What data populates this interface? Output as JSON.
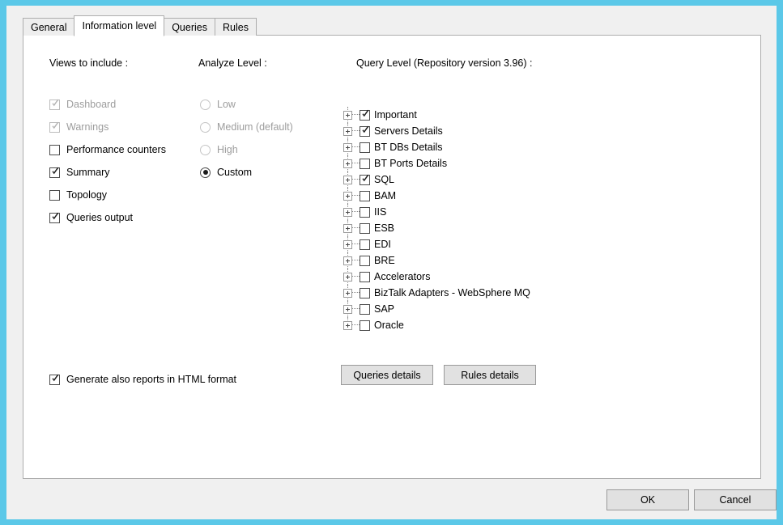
{
  "window": {
    "frame_color": "#5bc8e8",
    "dialog_background": "#f0f0f0",
    "panel_background": "#ffffff"
  },
  "tabs": [
    {
      "label": "General",
      "active": false
    },
    {
      "label": "Information level",
      "active": true
    },
    {
      "label": "Queries",
      "active": false
    },
    {
      "label": "Rules",
      "active": false
    }
  ],
  "views": {
    "header": "Views to include :",
    "items": [
      {
        "label": "Dashboard",
        "checked": true,
        "enabled": false
      },
      {
        "label": "Warnings",
        "checked": true,
        "enabled": false
      },
      {
        "label": "Performance counters",
        "checked": false,
        "enabled": true
      },
      {
        "label": "Summary",
        "checked": true,
        "enabled": true
      },
      {
        "label": "Topology",
        "checked": false,
        "enabled": true
      },
      {
        "label": "Queries output",
        "checked": true,
        "enabled": true
      }
    ]
  },
  "analyze_level": {
    "header": "Analyze Level :",
    "options": [
      {
        "label": "Low",
        "selected": false,
        "enabled": false
      },
      {
        "label": "Medium (default)",
        "selected": false,
        "enabled": false
      },
      {
        "label": "High",
        "selected": false,
        "enabled": false
      },
      {
        "label": "Custom",
        "selected": true,
        "enabled": true
      }
    ]
  },
  "query_level": {
    "header": "Query Level (Repository version 3.96) :",
    "repository_version": "3.96",
    "nodes": [
      {
        "label": "Important",
        "checked": true,
        "expandable": true
      },
      {
        "label": "Servers Details",
        "checked": true,
        "expandable": true
      },
      {
        "label": "BT DBs Details",
        "checked": false,
        "expandable": true
      },
      {
        "label": "BT Ports Details",
        "checked": false,
        "expandable": true
      },
      {
        "label": "SQL",
        "checked": true,
        "expandable": true
      },
      {
        "label": "BAM",
        "checked": false,
        "expandable": true
      },
      {
        "label": "IIS",
        "checked": false,
        "expandable": true
      },
      {
        "label": "ESB",
        "checked": false,
        "expandable": true
      },
      {
        "label": "EDI",
        "checked": false,
        "expandable": true
      },
      {
        "label": "BRE",
        "checked": false,
        "expandable": true
      },
      {
        "label": "Accelerators",
        "checked": false,
        "expandable": true
      },
      {
        "label": "BizTalk Adapters - WebSphere MQ",
        "checked": false,
        "expandable": true
      },
      {
        "label": "SAP",
        "checked": false,
        "expandable": true
      },
      {
        "label": "Oracle",
        "checked": false,
        "expandable": true
      }
    ]
  },
  "html_format": {
    "label": "Generate also reports in HTML format",
    "checked": true
  },
  "detail_buttons": {
    "queries": "Queries details",
    "rules": "Rules details"
  },
  "footer": {
    "ok": "OK",
    "cancel": "Cancel"
  }
}
